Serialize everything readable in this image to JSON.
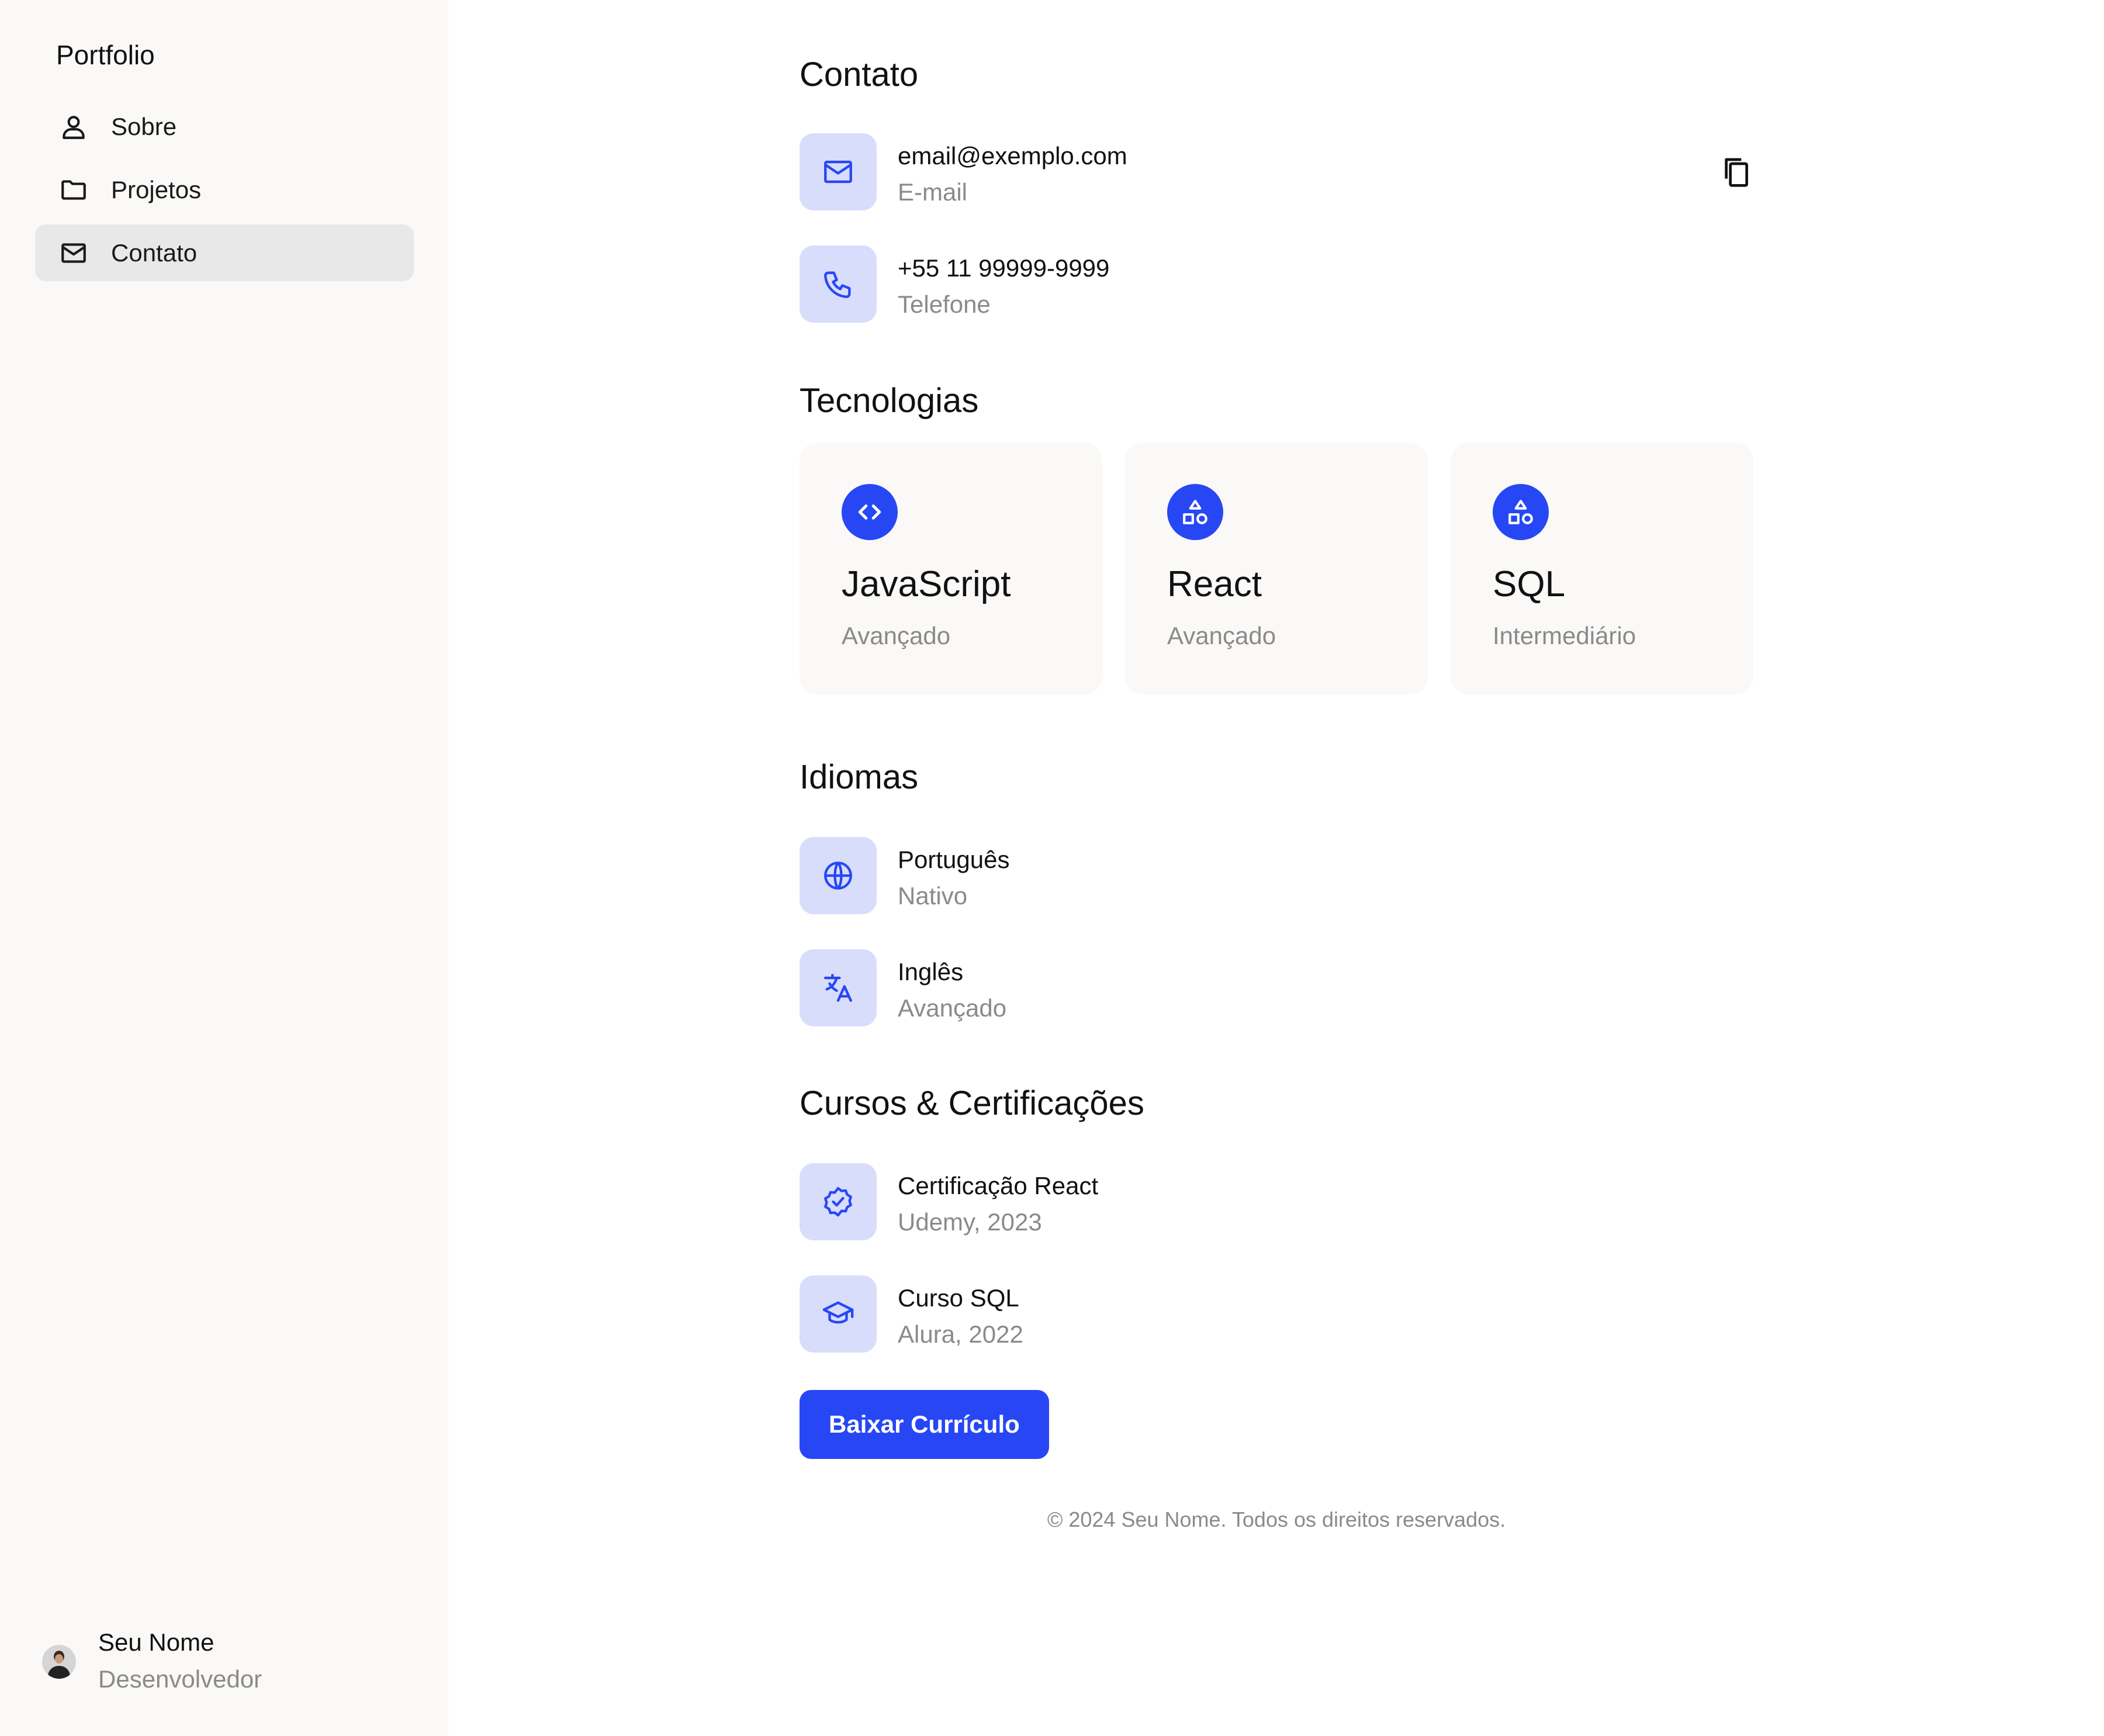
{
  "sidebar": {
    "brand": "Portfolio",
    "nav": [
      {
        "label": "Sobre",
        "icon": "user-icon"
      },
      {
        "label": "Projetos",
        "icon": "folder-icon"
      },
      {
        "label": "Contato",
        "icon": "mail-icon",
        "active": true
      }
    ],
    "profile": {
      "name": "Seu Nome",
      "role": "Desenvolvedor"
    }
  },
  "contact": {
    "title": "Contato",
    "items": [
      {
        "value": "email@exemplo.com",
        "label": "E-mail",
        "icon": "mail-icon"
      },
      {
        "value": "+55 11 99999-9999",
        "label": "Telefone",
        "icon": "phone-icon"
      }
    ],
    "copy_icon": "copy-icon"
  },
  "technologies": {
    "title": "Tecnologias",
    "items": [
      {
        "name": "JavaScript",
        "level": "Avançado",
        "icon": "code-icon"
      },
      {
        "name": "React",
        "level": "Avançado",
        "icon": "shapes-icon"
      },
      {
        "name": "SQL",
        "level": "Intermediário",
        "icon": "shapes-icon"
      }
    ]
  },
  "languages": {
    "title": "Idiomas",
    "items": [
      {
        "name": "Português",
        "level": "Nativo",
        "icon": "globe-icon"
      },
      {
        "name": "Inglês",
        "level": "Avançado",
        "icon": "translate-icon"
      }
    ]
  },
  "courses": {
    "title": "Cursos & Certificações",
    "items": [
      {
        "name": "Certificação React",
        "detail": "Udemy, 2023",
        "icon": "badge-check-icon"
      },
      {
        "name": "Curso SQL",
        "detail": "Alura, 2022",
        "icon": "graduation-cap-icon"
      }
    ]
  },
  "cta": {
    "label": "Baixar Currículo"
  },
  "footer": {
    "text": "© 2024 Seu Nome. Todos os direitos reservados."
  },
  "colors": {
    "accent": "#2747f5",
    "tile_bg": "#d8ddfc",
    "sidebar_bg": "#faf9f7",
    "active_nav": "#e8e8e8",
    "muted_text": "#8a8a8a"
  }
}
